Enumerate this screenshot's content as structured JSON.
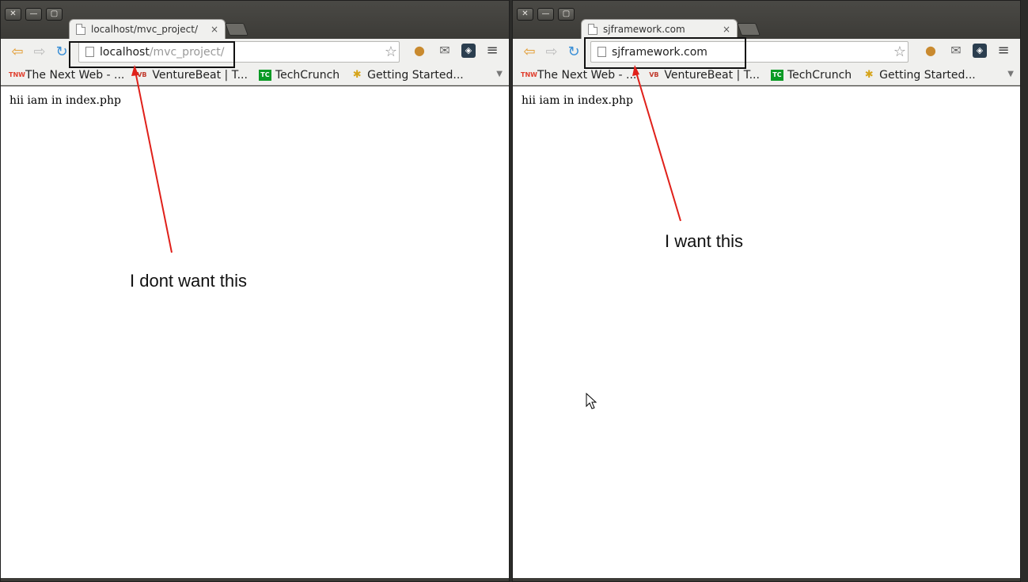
{
  "left_window": {
    "tab_title": "localhost/mvc_project/",
    "tab_close": "×",
    "url_host": "localhost",
    "url_path": "/mvc_project/",
    "page_text": "hii iam in index.php",
    "annotation": "I dont want this"
  },
  "right_window": {
    "tab_title": "sjframework.com",
    "tab_close": "×",
    "url_host": "sjframework.com",
    "url_path": "",
    "page_text": "hii iam in index.php",
    "annotation": "I want this"
  },
  "window_buttons": {
    "close": "✕",
    "minimize": "—",
    "maximize": "▢"
  },
  "toolbar": {
    "back": "⇦",
    "forward": "⇨",
    "reload": "↻",
    "star": "☆",
    "cookie": "●",
    "mail": "✉",
    "ext": "◈",
    "menu": "≡"
  },
  "bookmarks": [
    {
      "icon": "TNW",
      "label": "The Next Web - ..."
    },
    {
      "icon": "VB",
      "label": "VentureBeat | T..."
    },
    {
      "icon": "TC",
      "label": "TechCrunch"
    },
    {
      "icon": "✱",
      "label": "Getting Started..."
    }
  ],
  "bookmarks_overflow": "▼",
  "colors": {
    "annotation_line": "#e0201a",
    "annotation_box": "#111111"
  }
}
